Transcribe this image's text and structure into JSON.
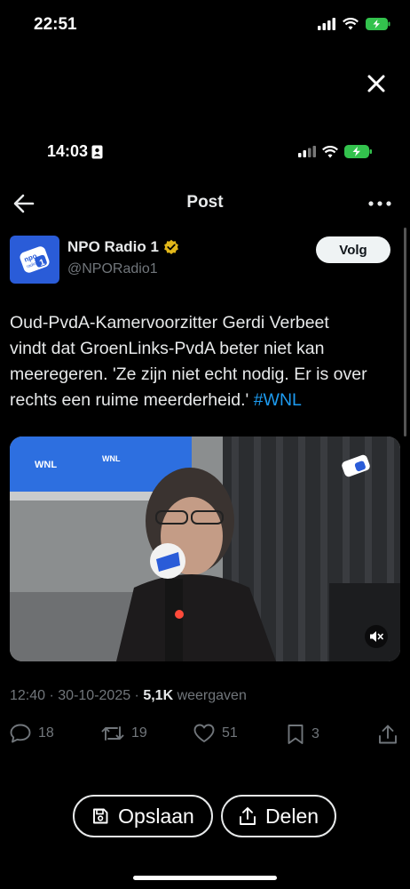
{
  "outer_status": {
    "time": "22:51"
  },
  "inner_status": {
    "time": "14:03"
  },
  "header": {
    "title": "Post"
  },
  "account": {
    "name": "NPO Radio 1",
    "handle": "@NPORadio1",
    "follow_label": "Volg",
    "avatar_text_top": "npo",
    "avatar_text_mid": "radio",
    "avatar_text_num": "1"
  },
  "tweet": {
    "text_line1": "Oud-PvdA-Kamervoorzitter Gerdi Verbeet",
    "text_line2": "vindt dat GroenLinks-PvdA beter niet kan",
    "text_line3": "meeregeren. 'Ze zijn niet echt nodig. Er is over",
    "text_line4": "rechts een ruime meerderheid.'",
    "hashtag": "#WNL"
  },
  "video": {
    "screen_label_1": "WNL",
    "screen_label_2": "WNL"
  },
  "meta": {
    "time": "12:40",
    "date": "30-10-2025",
    "views_count": "5,1K",
    "views_label": "weergaven"
  },
  "actions": {
    "replies": "18",
    "reposts": "19",
    "likes": "51",
    "bookmarks": "3"
  },
  "bottom": {
    "save_label": "Opslaan",
    "share_label": "Delen"
  },
  "colors": {
    "accent": "#1d9bf0",
    "verified": "#e2b719",
    "battery": "#33c24d",
    "avatar_bg": "#2a5cd8"
  }
}
